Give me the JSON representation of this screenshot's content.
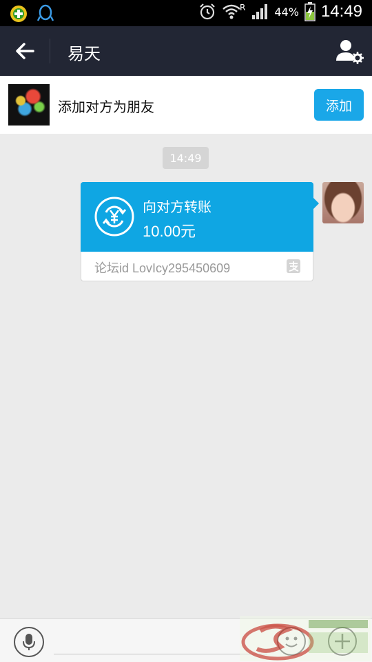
{
  "status_bar": {
    "battery_percent": "44%",
    "time": "14:49",
    "roaming": "R"
  },
  "header": {
    "title": "易天"
  },
  "add_friend": {
    "prompt": "添加对方为朋友",
    "button_label": "添加"
  },
  "chat": {
    "timestamp": "14:49",
    "transfer": {
      "title": "向对方转账",
      "amount": "10.00元",
      "note": "论坛id LovIcy295450609"
    }
  },
  "input_bar": {
    "placeholder": ""
  },
  "colors": {
    "header_bg": "#222634",
    "accent_blue": "#0fa6e3",
    "add_button": "#1aa7e8",
    "chat_bg": "#ebebeb"
  }
}
